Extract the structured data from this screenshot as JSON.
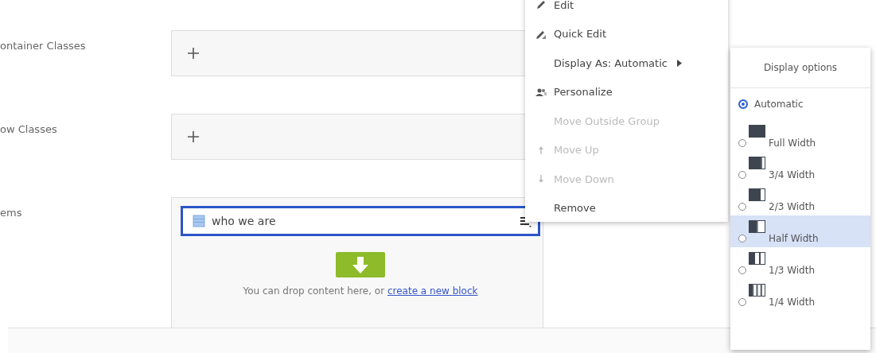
{
  "fields": [
    {
      "label": "ontainer Classes",
      "kind": "add"
    },
    {
      "label": "ow Classes",
      "kind": "add"
    },
    {
      "label": "ems",
      "kind": "content"
    }
  ],
  "content_area": {
    "item": {
      "name": "who we are",
      "selected": true
    },
    "drop_text": "You can drop content here, or ",
    "drop_link": "create a new block"
  },
  "context_menu": {
    "items": [
      {
        "label": "Edit",
        "kind": "edit",
        "disabled": false
      },
      {
        "label": "Quick Edit",
        "kind": "quick-edit",
        "disabled": false
      },
      {
        "label": "Display As: Automatic",
        "kind": "submenu",
        "disabled": false
      },
      {
        "label": "Personalize",
        "kind": "personalize",
        "disabled": false
      },
      {
        "label": "Move Outside Group",
        "kind": "plain",
        "disabled": true
      },
      {
        "label": "Move Up",
        "kind": "move-up",
        "disabled": true
      },
      {
        "label": "Move Down",
        "kind": "move-down",
        "disabled": true
      },
      {
        "label": "Remove",
        "kind": "plain",
        "disabled": false
      }
    ]
  },
  "display_options": {
    "title": "Display options",
    "options": [
      {
        "label": "Automatic",
        "kind": "automatic",
        "selected": true,
        "hovered": false
      },
      {
        "label": "Full Width",
        "kind": "full",
        "selected": false,
        "hovered": false
      },
      {
        "label": "3/4 Width",
        "kind": "three-quarters",
        "selected": false,
        "hovered": false
      },
      {
        "label": "2/3 Width",
        "kind": "two-thirds",
        "selected": false,
        "hovered": false
      },
      {
        "label": "Half Width",
        "kind": "half",
        "selected": false,
        "hovered": true
      },
      {
        "label": "1/3 Width",
        "kind": "third",
        "selected": false,
        "hovered": false
      },
      {
        "label": "1/4 Width",
        "kind": "quarter",
        "selected": false,
        "hovered": false
      }
    ]
  }
}
